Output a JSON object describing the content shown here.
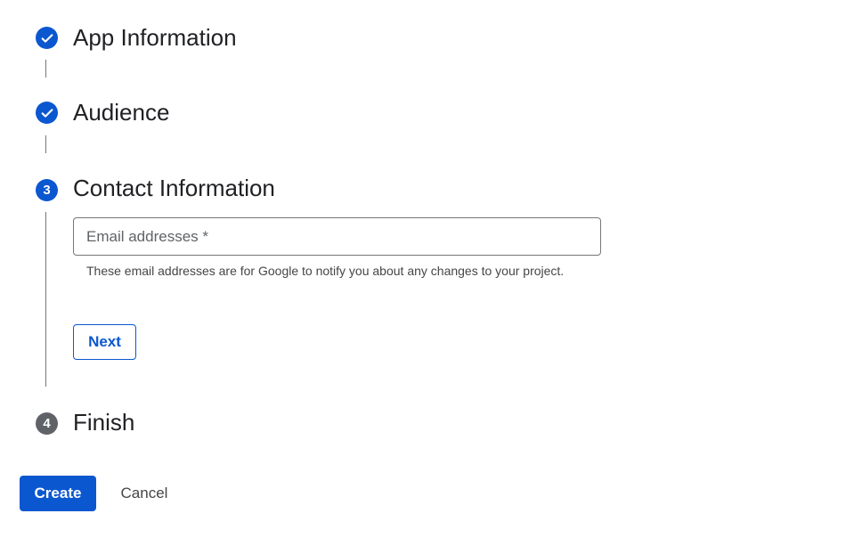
{
  "stepper": {
    "steps": [
      {
        "status": "completed",
        "title": "App Information"
      },
      {
        "status": "completed",
        "title": "Audience"
      },
      {
        "number": "3",
        "status": "active",
        "title": "Contact Information"
      },
      {
        "number": "4",
        "status": "pending",
        "title": "Finish"
      }
    ]
  },
  "contact": {
    "email_placeholder": "Email addresses *",
    "email_value": "",
    "helper_text": "These email addresses are for Google to notify you about any changes to your project.",
    "next_label": "Next"
  },
  "actions": {
    "create_label": "Create",
    "cancel_label": "Cancel"
  },
  "colors": {
    "primary": "#0b57d0",
    "pending_step": "#5f6368",
    "connector": "#747775"
  },
  "icons": {
    "completed_step": "check-icon"
  }
}
